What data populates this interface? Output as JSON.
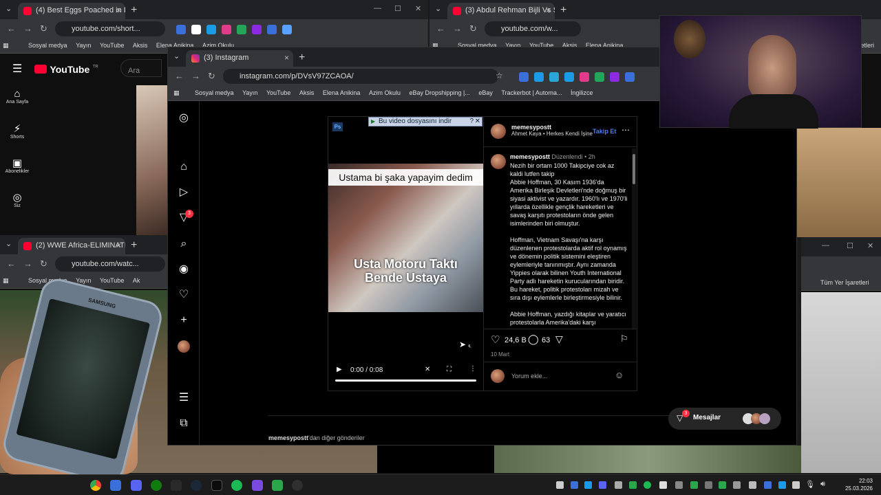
{
  "yt_left_window": {
    "tab_title": "(4) Best Eggs Poached in Iro",
    "url": "youtube.com/short...",
    "bookmarks": [
      "Sosyal medya",
      "Yayın",
      "YouTube",
      "Aksis",
      "Elena Anikina",
      "Azim Okulu"
    ],
    "logo": "YouTube",
    "logo_sup": "TR",
    "search_placeholder": "Ara",
    "nav": [
      {
        "label": "Ana Sayfa",
        "icon": "home-icon"
      },
      {
        "label": "Shorts",
        "icon": "shorts-icon"
      },
      {
        "label": "Abonelikler",
        "icon": "subscriptions-icon"
      },
      {
        "label": "Siz",
        "icon": "account-icon"
      }
    ]
  },
  "yt_right_window": {
    "tab_title": "(3) Abdul Rehman Bijli Vs Si",
    "url": "youtube.com/w...",
    "bookmarks": [
      "Sosyal medya",
      "Yayın",
      "YouTube",
      "Aksis",
      "Elena Anikina"
    ],
    "bookmarks_end": "Tüm Yer İşaretleri"
  },
  "wwe_window": {
    "tab_title": "(2) WWE Africa-ELIMINATIO",
    "url": "youtube.com/watc...",
    "bookmarks": [
      "Sosyal medya",
      "Yayın",
      "YouTube",
      "Ak"
    ]
  },
  "right_lower_window": {
    "bookmarks_end": "Tüm Yer İşaretleri"
  },
  "instagram_window": {
    "tab_title": "(3) Instagram",
    "url": "instagram.com/p/DVsV97ZCAOA/",
    "bookmarks": [
      "Sosyal medya",
      "Yayın",
      "YouTube",
      "Aksis",
      "Elena Anikina",
      "Azim Okulu",
      "eBay Dropshipping |...",
      "eBay",
      "Trackerbot | Automa...",
      "İngilizce"
    ],
    "sidebar_badge": "3",
    "download_bar": "Bu video dosyasını indir",
    "download_help": "?",
    "ps_label": "Ps",
    "video_caption_top": "Ustama bi şaka yapayim dedim",
    "video_caption_bottom": "Usta Motoru Taktı\nBende Ustaya",
    "video_time": "0:00 / 0:08",
    "post": {
      "username": "memesypostt",
      "audio_artist": "Ahmet Kaya",
      "audio_track": "Herkes Kendi İşine",
      "follow_label": "Takip Et",
      "caption_user": "memesypostt",
      "edited": "Düzenlendi",
      "time": "2h",
      "caption_paragraphs": [
        "Nezih bir ortam 1000 Takipciye cok az kaldi lutfen takip\nAbbie Hoffman, 30 Kasım 1936'da Amerika Birleşik Devletleri'nde doğmuş bir siyasi aktivist ve yazardır. 1960'lı ve 1970'li yıllarda özellikle gençlik hareketleri ve savaş karşıtı protestoların önde gelen isimlerinden biri olmuştur.",
        "Hoffman, Vietnam Savaşı'na karşı düzenlenen protestolarda aktif rol oynamış ve dönemin politik sistemini eleştiren eylemleriyle tanınmıştır. Aynı zamanda Yippies olarak bilinen Youth International Party adlı hareketin kurucularından biridir. Bu hareket, politik protestoları mizah ve sıra dışı eylemlerle birleştirmesiyle bilinir.",
        "Abbie Hoffman, yazdığı kitaplar ve yaratıcı protestolarla Amerika'daki karşı"
      ],
      "likes": "24,6 B",
      "comments": "63",
      "date": "10 Mart",
      "comment_placeholder": "Yorum ekle..."
    },
    "messages_label": "Mesajlar",
    "messages_badge": "3",
    "more_posts_user": "memesypostt",
    "more_posts_suffix": "'dan diğer gönderiler"
  },
  "phone_brand": "SAMSUNG",
  "taskbar": {
    "time": "22:03",
    "date": "25.03.2026"
  },
  "colors": {
    "instagram_link_blue": "#4f7bff",
    "youtube_red": "#ff0033",
    "notification_red": "#ff3040"
  }
}
